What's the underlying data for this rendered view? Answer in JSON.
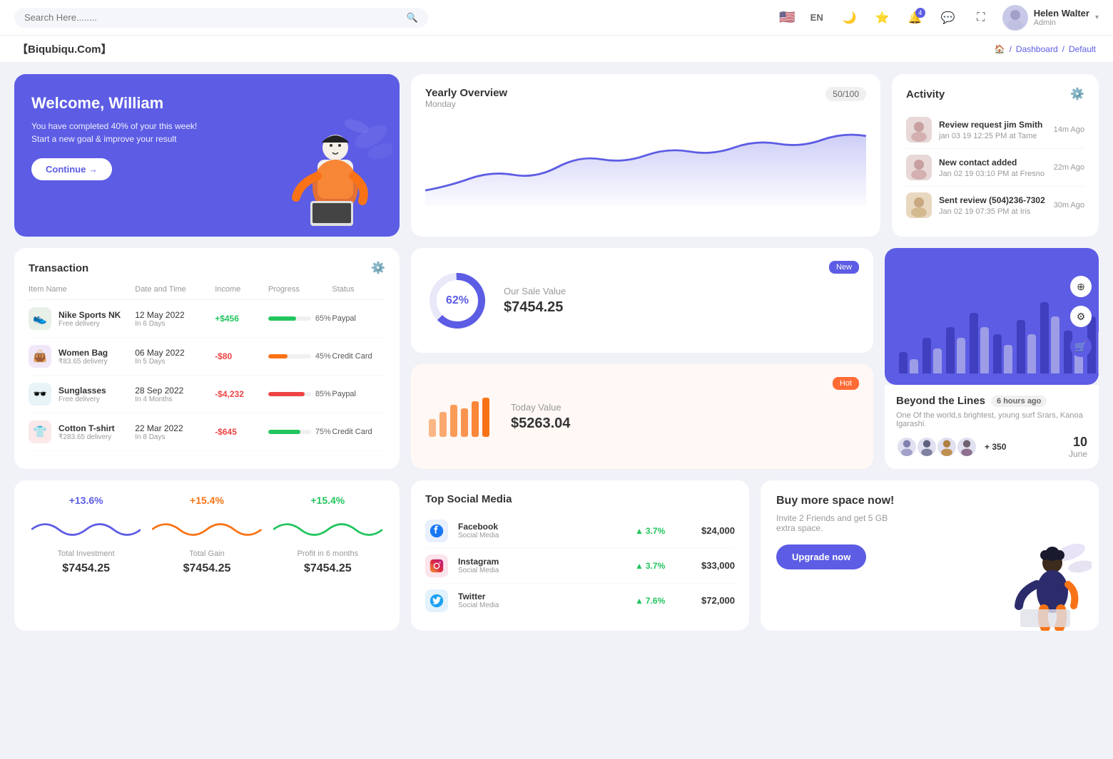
{
  "topNav": {
    "search_placeholder": "Search Here........",
    "lang": "EN",
    "bell_badge": "4",
    "user_name": "Helen Walter",
    "user_role": "Admin"
  },
  "breadcrumb": {
    "brand": "【Biqubiqu.Com】",
    "home": "🏠",
    "dashboard": "Dashboard",
    "current": "Default"
  },
  "welcome": {
    "title": "Welcome, William",
    "subtitle": "You have completed 40% of your this week! Start a new goal & improve your result",
    "button": "Continue →"
  },
  "yearlyOverview": {
    "title": "Yearly Overview",
    "badge": "50/100",
    "subtitle": "Monday"
  },
  "activity": {
    "title": "Activity",
    "items": [
      {
        "title": "Review request jim Smith",
        "detail": "jan 03 19 12:25 PM at Tame",
        "time": "14m Ago"
      },
      {
        "title": "New contact added",
        "detail": "Jan 02 19 03:10 PM at Fresno",
        "time": "22m Ago"
      },
      {
        "title": "Sent review (504)236-7302",
        "detail": "Jan 02 19 07:35 PM at Iris",
        "time": "30m Ago"
      }
    ]
  },
  "transaction": {
    "title": "Transaction",
    "columns": [
      "Item Name",
      "Date and Time",
      "Income",
      "Progress",
      "Status"
    ],
    "rows": [
      {
        "icon": "👟",
        "name": "Nike Sports NK",
        "sub": "Free delivery",
        "date": "12 May 2022",
        "dateSub": "In 6 Days",
        "income": "+$456",
        "incomeType": "pos",
        "progress": 65,
        "progressColor": "#22c55e",
        "status": "Paypal"
      },
      {
        "icon": "👜",
        "name": "Women Bag",
        "sub": "₹83.65 delivery",
        "date": "06 May 2022",
        "dateSub": "In 5 Days",
        "income": "-$80",
        "incomeType": "neg",
        "progress": 45,
        "progressColor": "#f97316",
        "status": "Credit Card"
      },
      {
        "icon": "🕶️",
        "name": "Sunglasses",
        "sub": "Free delivery",
        "date": "28 Sep 2022",
        "dateSub": "In 4 Months",
        "income": "-$4,232",
        "incomeType": "neg",
        "progress": 85,
        "progressColor": "#ef4444",
        "status": "Paypal"
      },
      {
        "icon": "👕",
        "name": "Cotton T-shirt",
        "sub": "₹283.65 delivery",
        "date": "22 Mar 2022",
        "dateSub": "In 8 Days",
        "income": "-$645",
        "incomeType": "neg",
        "progress": 75,
        "progressColor": "#22c55e",
        "status": "Credit Card"
      }
    ]
  },
  "saleNew": {
    "badge": "New",
    "label": "Our Sale Value",
    "value": "$7454.25",
    "percent": "62%"
  },
  "saleHot": {
    "badge": "Hot",
    "label": "Today Value",
    "value": "$5263.04"
  },
  "barChart": {
    "bars": [
      20,
      40,
      55,
      70,
      45,
      60,
      80,
      50,
      65,
      90,
      75,
      100,
      85,
      110,
      95,
      70,
      120,
      105,
      80,
      130
    ]
  },
  "beyondLines": {
    "title": "Beyond the Lines",
    "time": "6 hours ago",
    "desc": "One Of the world,s brightest, young surf Srars, Kanoa Igarashi.",
    "plusCount": "+ 350",
    "date": "10",
    "month": "June"
  },
  "miniStats": [
    {
      "pct": "+13.6%",
      "pctColor": "#5c5ce4",
      "label": "Total Investment",
      "value": "$7454.25",
      "waveColor": "#5c5ce4"
    },
    {
      "pct": "+15.4%",
      "pctColor": "#f97316",
      "label": "Total Gain",
      "value": "$7454.25",
      "waveColor": "#f97316"
    },
    {
      "pct": "+15.4%",
      "pctColor": "#22c55e",
      "label": "Profit in 6 months",
      "value": "$7454.25",
      "waveColor": "#22c55e"
    }
  ],
  "topSocialMedia": {
    "title": "Top Social Media",
    "items": [
      {
        "icon": "📘",
        "iconBg": "#e8f0fe",
        "name": "Facebook",
        "type": "Social Media",
        "pct": "3.7%",
        "value": "$24,000"
      },
      {
        "icon": "📸",
        "iconBg": "#fce4ec",
        "name": "Instagram",
        "type": "Social Media",
        "pct": "3.7%",
        "value": "$33,000"
      },
      {
        "icon": "🐦",
        "iconBg": "#e3f2fd",
        "name": "Twitter",
        "type": "Social Media",
        "pct": "7.6%",
        "value": "$72,000"
      }
    ]
  },
  "upgrade": {
    "title": "Buy more space now!",
    "desc": "Invite 2 Friends and get 5 GB extra space.",
    "button": "Upgrade now"
  }
}
